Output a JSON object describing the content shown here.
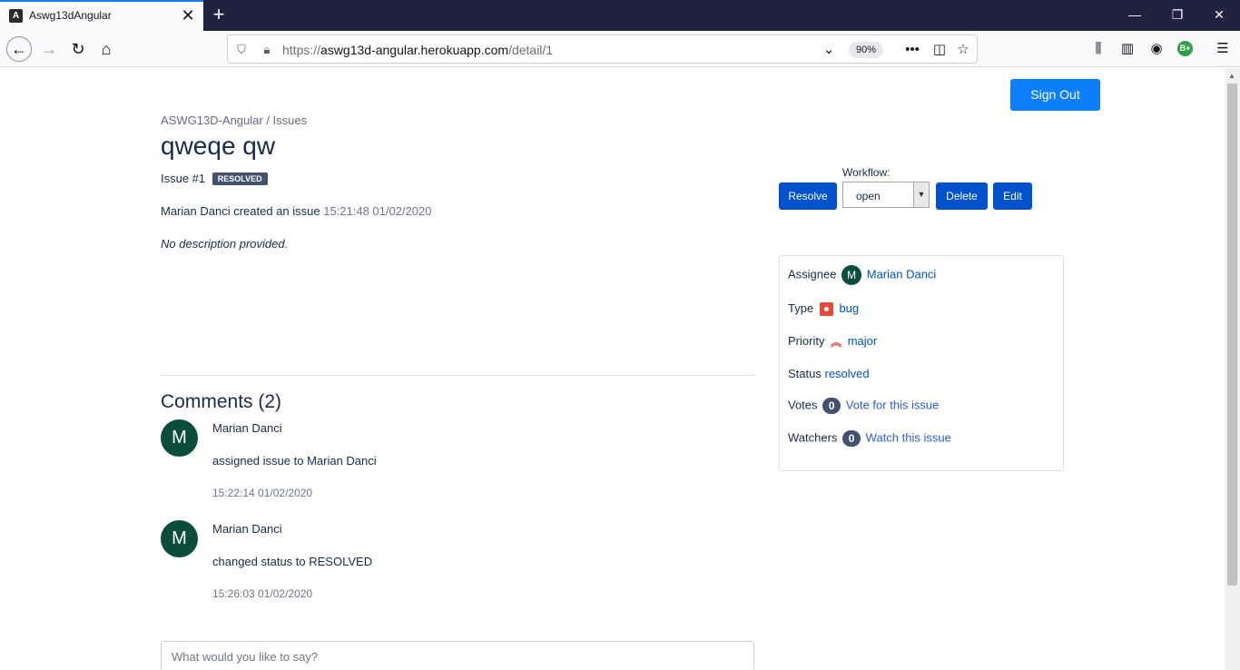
{
  "browser": {
    "tab_title": "Aswg13dAngular",
    "tab_favicon": "A",
    "url_prefix": "https://",
    "url_host": "aswg13d-angular.herokuapp.com",
    "url_path": "/detail/1",
    "zoom": "90%",
    "extension_badge": "B+"
  },
  "header": {
    "sign_out_label": "Sign Out"
  },
  "issue": {
    "breadcrumb": "ASWG13D-Angular / Issues",
    "title": "qweqe qw",
    "number_label": "Issue #1",
    "status_badge": "RESOLVED",
    "created_text": "Marian Danci created an issue",
    "created_time": "15:21:48 01/02/2020",
    "description": "No description provided."
  },
  "actions": {
    "resolve_label": "Resolve",
    "workflow_label": "Workflow:",
    "workflow_value": "open",
    "delete_label": "Delete",
    "edit_label": "Edit"
  },
  "details": {
    "assignee_label": "Assignee",
    "assignee_initial": "M",
    "assignee_name": "Marian Danci",
    "type_label": "Type",
    "type_value": "bug",
    "priority_label": "Priority",
    "priority_value": "major",
    "status_label": "Status",
    "status_value": "resolved",
    "votes_label": "Votes",
    "votes_count": "0",
    "vote_link": "Vote for this issue",
    "watchers_label": "Watchers",
    "watchers_count": "0",
    "watch_link": "Watch this issue"
  },
  "comments": {
    "heading": "Comments (2)",
    "items": [
      {
        "initial": "M",
        "author": "Marian Danci",
        "text": "assigned issue to Marian Danci",
        "time": "15:22:14 01/02/2020"
      },
      {
        "initial": "M",
        "author": "Marian Danci",
        "text": "changed status to RESOLVED",
        "time": "15:26:03 01/02/2020"
      }
    ],
    "input_placeholder": "What would you like to say?"
  },
  "colors": {
    "primary_button": "#0d7ffb",
    "action_button": "#0052cc",
    "avatar": "#0b4d3c",
    "link": "#0052cc",
    "bug_red": "#e5493a",
    "badge": "#42526e"
  },
  "icons": [
    "angular-favicon",
    "close-icon",
    "plus-icon",
    "back-arrow-icon",
    "forward-arrow-icon",
    "reload-icon",
    "home-icon",
    "shield-icon",
    "lock-icon",
    "chevron-down-icon",
    "more-icon",
    "pocket-icon",
    "star-icon",
    "library-icon",
    "sidebar-icon",
    "account-icon",
    "menu-icon",
    "bug-icon",
    "priority-major-icon"
  ]
}
